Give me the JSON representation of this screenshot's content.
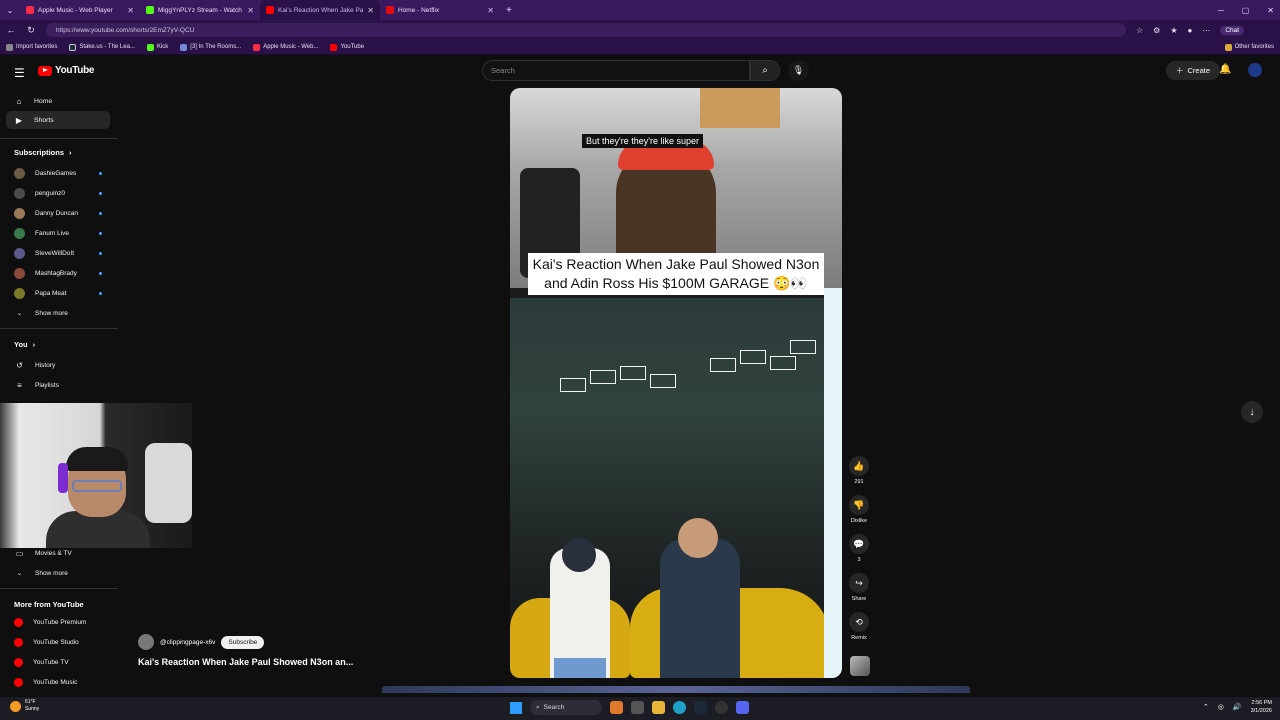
{
  "browser": {
    "tabs": [
      {
        "title": "Apple Music - Web Player",
        "color": "#fa2d48",
        "active": false
      },
      {
        "title": "MiggYnPLYz Stream - Watch Live",
        "color": "#53fc18",
        "active": false
      },
      {
        "title": "Kai's Reaction When Jake Paul Sh...",
        "color": "#ff0000",
        "active": true
      },
      {
        "title": "Home - Netflix",
        "color": "#e50914",
        "active": false
      }
    ],
    "new_tab": "+",
    "url": "https://www.youtube.com/shorts/2EmZ7yV-QCU",
    "chat_label": "Chat",
    "favorites": [
      {
        "label": "Import favorites",
        "color": "#888888"
      },
      {
        "label": "Stake.us - The Lea...",
        "color": "#1a2c38"
      },
      {
        "label": "Kick",
        "color": "#53fc18"
      },
      {
        "label": "[3] In The Rooms...",
        "color": "#7289da"
      },
      {
        "label": "Apple Music - Web...",
        "color": "#fa2d48"
      },
      {
        "label": "YouTube",
        "color": "#ff0000"
      }
    ],
    "other_favorites": "Other favorites"
  },
  "youtube": {
    "logo": "YouTube",
    "search_placeholder": "Search",
    "create_label": "Create",
    "nav": [
      {
        "label": "Home",
        "icon": "home-icon",
        "glyph": "⌂"
      },
      {
        "label": "Shorts",
        "icon": "shorts-icon",
        "glyph": "▶"
      }
    ],
    "subscriptions_label": "Subscriptions",
    "subscriptions": [
      {
        "name": "DashieGames",
        "color": "#6b5a44"
      },
      {
        "name": "penguinz0",
        "color": "#4b4b4b"
      },
      {
        "name": "Danny Duncan",
        "color": "#9a7a5a"
      },
      {
        "name": "Fanum Live",
        "color": "#3a7a4a"
      },
      {
        "name": "SteveWillDoIt",
        "color": "#5a5a8a"
      },
      {
        "name": "MashtagBrady",
        "color": "#8a4a3a"
      },
      {
        "name": "Papa Meat",
        "color": "#7a7a2a"
      }
    ],
    "show_more": "Show more",
    "you_label": "You",
    "you_items": [
      {
        "label": "History",
        "glyph": "↺"
      },
      {
        "label": "Playlists",
        "glyph": "≡"
      }
    ],
    "lower_items": [
      {
        "label": "Movies & TV",
        "glyph": "▭"
      }
    ],
    "show_more_2": "Show more",
    "more_from_label": "More from YouTube",
    "more_from": [
      {
        "label": "YouTube Premium"
      },
      {
        "label": "YouTube Studio"
      },
      {
        "label": "YouTube TV"
      },
      {
        "label": "YouTube Music"
      }
    ]
  },
  "short": {
    "subtitle": "But they're they're like super",
    "title_card": "Kai's Reaction When Jake Paul Showed N3on and Adin Ross His $100M GARAGE 😳👀",
    "channel_handle": "@clippingpage-x6v",
    "subscribe_label": "Subscribe",
    "video_title": "Kai's Reaction When Jake Paul Showed N3on an...",
    "actions": {
      "like_count": "291",
      "dislike_label": "Dislike",
      "comment_count": "3",
      "share_label": "Share",
      "remix_label": "Remix"
    }
  },
  "taskbar": {
    "weather_temp": "61°F",
    "weather_cond": "Sunny",
    "search_label": "Search",
    "time": "2:56 PM",
    "date": "3/1/2026"
  }
}
